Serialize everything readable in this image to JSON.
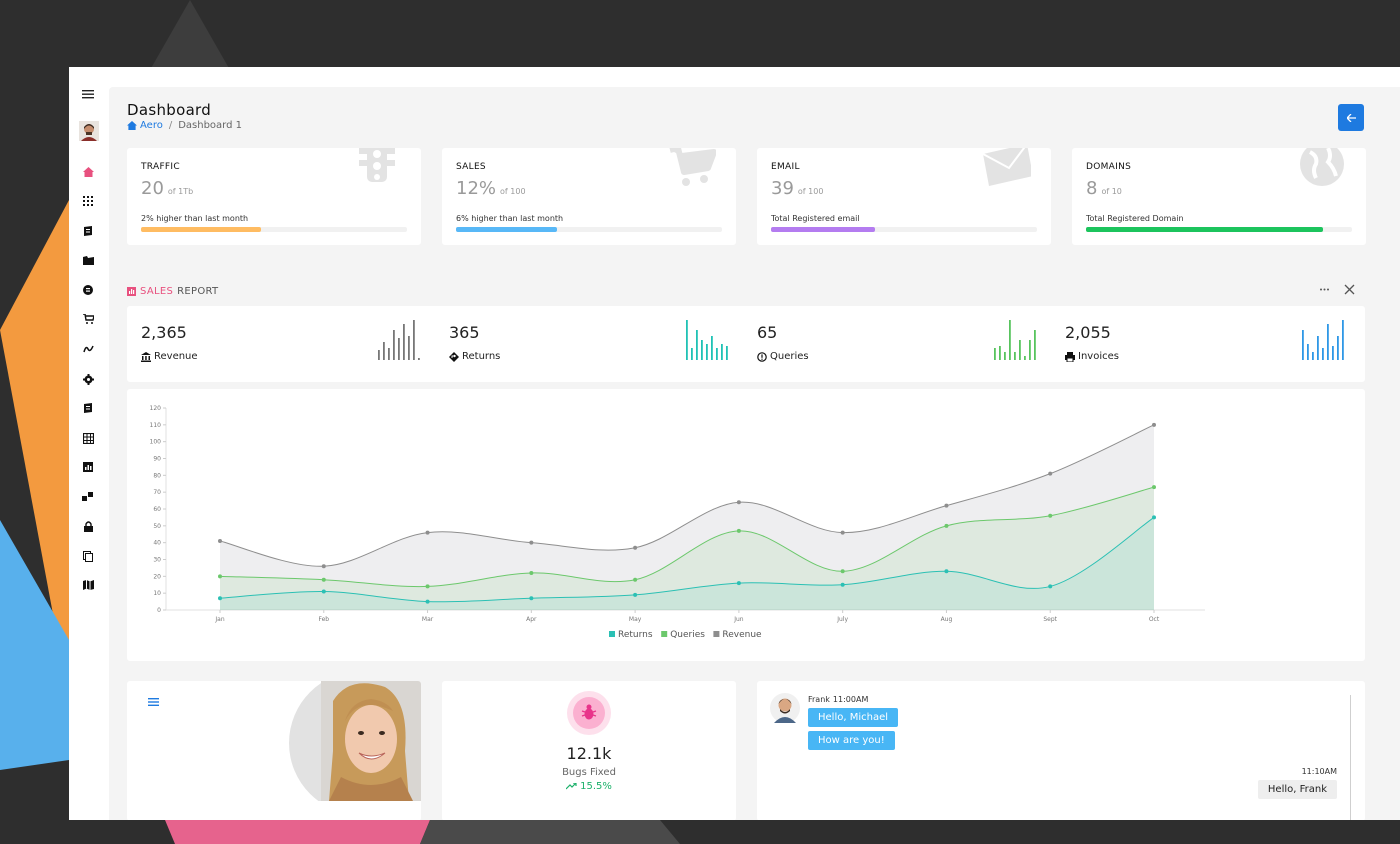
{
  "window": {
    "title": "Dashboard"
  },
  "breadcrumb": {
    "home": "Aero",
    "sep": "/",
    "current": "Dashboard 1"
  },
  "header": {
    "back_icon": "arrow-left-icon"
  },
  "stats": [
    {
      "label": "TRAFFIC",
      "value": "20",
      "sub": "of 1Tb",
      "desc": "2% higher than last month",
      "progress": 0.45,
      "color": "#ffbc62",
      "icon": "traffic-light-icon"
    },
    {
      "label": "SALES",
      "value": "12%",
      "sub": "of 100",
      "desc": "6% higher than last month",
      "progress": 0.38,
      "color": "#58b8f7",
      "icon": "cart-icon"
    },
    {
      "label": "EMAIL",
      "value": "39",
      "sub": "of 100",
      "desc": "Total Registered email",
      "progress": 0.39,
      "color": "#b47cf0",
      "icon": "envelope-icon"
    },
    {
      "label": "DOMAINS",
      "value": "8",
      "sub": "of 10",
      "desc": "Total Registered Domain",
      "progress": 0.89,
      "color": "#1cc45d",
      "icon": "globe-icon"
    }
  ],
  "sales_report": {
    "title_accent": "SALES",
    "title_rest": "REPORT",
    "tools": [
      "more-icon",
      "close-icon"
    ],
    "items": [
      {
        "value": "2,365",
        "label": "Revenue",
        "icon": "bank-icon",
        "color": "#777777",
        "bars": [
          0.25,
          0.45,
          0.3,
          0.75,
          0.55,
          0.9,
          0.6,
          1.0,
          0.05
        ]
      },
      {
        "value": "365",
        "label": "Returns",
        "icon": "diamond-arrow-icon",
        "color": "#20c2b5",
        "bars": [
          1.0,
          0.3,
          0.75,
          0.5,
          0.4,
          0.6,
          0.3,
          0.4,
          0.35
        ]
      },
      {
        "value": "65",
        "label": "Queries",
        "icon": "exclamation-icon",
        "color": "#58c45e",
        "bars": [
          0.3,
          0.35,
          0.2,
          1.0,
          0.2,
          0.5,
          0.1,
          0.5,
          0.75
        ]
      },
      {
        "value": "2,055",
        "label": "Invoices",
        "icon": "printer-icon",
        "color": "#2f98e6",
        "bars": [
          0.75,
          0.4,
          0.2,
          0.6,
          0.3,
          0.9,
          0.35,
          0.6,
          1.0
        ]
      }
    ]
  },
  "chart_data": {
    "type": "area",
    "categories": [
      "Jan",
      "Feb",
      "Mar",
      "Apr",
      "May",
      "Jun",
      "July",
      "Aug",
      "Sept",
      "Oct"
    ],
    "series": [
      {
        "name": "Revenue",
        "values": [
          41,
          26,
          46,
          40,
          37,
          64,
          46,
          62,
          81,
          110
        ],
        "color": "#8e8e8e"
      },
      {
        "name": "Queries",
        "values": [
          20,
          18,
          14,
          22,
          18,
          47,
          23,
          50,
          56,
          73
        ],
        "color": "#6cc86c"
      },
      {
        "name": "Returns",
        "values": [
          7,
          11,
          5,
          7,
          9,
          16,
          15,
          23,
          14,
          55
        ],
        "color": "#2bc0b4"
      }
    ],
    "legend_order": [
      "Returns",
      "Queries",
      "Revenue"
    ],
    "ylim": [
      0,
      120
    ],
    "yticks": [
      0,
      10,
      20,
      30,
      40,
      50,
      60,
      70,
      80,
      90,
      100,
      110,
      120
    ],
    "legend_position": "bottom",
    "grid": false
  },
  "profile_card": {
    "menu_icon": "hamburger-icon"
  },
  "bugs_card": {
    "value": "12.1k",
    "label": "Bugs Fixed",
    "trend": "15.5%",
    "icon": "bug-icon"
  },
  "chat": {
    "sender": "Frank",
    "time1": "11:00AM",
    "messages": [
      "Hello, Michael",
      "How are you!"
    ],
    "time2": "11:10AM",
    "reply": "Hello, Frank"
  },
  "sidebar": {
    "icons": [
      "menu-icon",
      "avatar",
      "home-icon",
      "apps-icon",
      "document-icon",
      "folder-icon",
      "blog-icon",
      "cart-icon",
      "swap-icon",
      "settings-icon",
      "notes-icon",
      "grid-icon",
      "chart-icon",
      "layers-icon",
      "lock-icon",
      "copy-icon",
      "map-icon"
    ]
  }
}
